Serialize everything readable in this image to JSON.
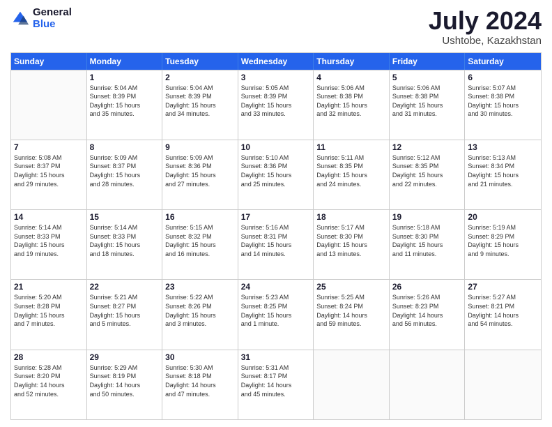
{
  "logo": {
    "general": "General",
    "blue": "Blue"
  },
  "title": "July 2024",
  "location": "Ushtobe, Kazakhstan",
  "header_days": [
    "Sunday",
    "Monday",
    "Tuesday",
    "Wednesday",
    "Thursday",
    "Friday",
    "Saturday"
  ],
  "weeks": [
    [
      {
        "day": "",
        "info": ""
      },
      {
        "day": "1",
        "info": "Sunrise: 5:04 AM\nSunset: 8:39 PM\nDaylight: 15 hours\nand 35 minutes."
      },
      {
        "day": "2",
        "info": "Sunrise: 5:04 AM\nSunset: 8:39 PM\nDaylight: 15 hours\nand 34 minutes."
      },
      {
        "day": "3",
        "info": "Sunrise: 5:05 AM\nSunset: 8:39 PM\nDaylight: 15 hours\nand 33 minutes."
      },
      {
        "day": "4",
        "info": "Sunrise: 5:06 AM\nSunset: 8:38 PM\nDaylight: 15 hours\nand 32 minutes."
      },
      {
        "day": "5",
        "info": "Sunrise: 5:06 AM\nSunset: 8:38 PM\nDaylight: 15 hours\nand 31 minutes."
      },
      {
        "day": "6",
        "info": "Sunrise: 5:07 AM\nSunset: 8:38 PM\nDaylight: 15 hours\nand 30 minutes."
      }
    ],
    [
      {
        "day": "7",
        "info": "Sunrise: 5:08 AM\nSunset: 8:37 PM\nDaylight: 15 hours\nand 29 minutes."
      },
      {
        "day": "8",
        "info": "Sunrise: 5:09 AM\nSunset: 8:37 PM\nDaylight: 15 hours\nand 28 minutes."
      },
      {
        "day": "9",
        "info": "Sunrise: 5:09 AM\nSunset: 8:36 PM\nDaylight: 15 hours\nand 27 minutes."
      },
      {
        "day": "10",
        "info": "Sunrise: 5:10 AM\nSunset: 8:36 PM\nDaylight: 15 hours\nand 25 minutes."
      },
      {
        "day": "11",
        "info": "Sunrise: 5:11 AM\nSunset: 8:35 PM\nDaylight: 15 hours\nand 24 minutes."
      },
      {
        "day": "12",
        "info": "Sunrise: 5:12 AM\nSunset: 8:35 PM\nDaylight: 15 hours\nand 22 minutes."
      },
      {
        "day": "13",
        "info": "Sunrise: 5:13 AM\nSunset: 8:34 PM\nDaylight: 15 hours\nand 21 minutes."
      }
    ],
    [
      {
        "day": "14",
        "info": "Sunrise: 5:14 AM\nSunset: 8:33 PM\nDaylight: 15 hours\nand 19 minutes."
      },
      {
        "day": "15",
        "info": "Sunrise: 5:14 AM\nSunset: 8:33 PM\nDaylight: 15 hours\nand 18 minutes."
      },
      {
        "day": "16",
        "info": "Sunrise: 5:15 AM\nSunset: 8:32 PM\nDaylight: 15 hours\nand 16 minutes."
      },
      {
        "day": "17",
        "info": "Sunrise: 5:16 AM\nSunset: 8:31 PM\nDaylight: 15 hours\nand 14 minutes."
      },
      {
        "day": "18",
        "info": "Sunrise: 5:17 AM\nSunset: 8:30 PM\nDaylight: 15 hours\nand 13 minutes."
      },
      {
        "day": "19",
        "info": "Sunrise: 5:18 AM\nSunset: 8:30 PM\nDaylight: 15 hours\nand 11 minutes."
      },
      {
        "day": "20",
        "info": "Sunrise: 5:19 AM\nSunset: 8:29 PM\nDaylight: 15 hours\nand 9 minutes."
      }
    ],
    [
      {
        "day": "21",
        "info": "Sunrise: 5:20 AM\nSunset: 8:28 PM\nDaylight: 15 hours\nand 7 minutes."
      },
      {
        "day": "22",
        "info": "Sunrise: 5:21 AM\nSunset: 8:27 PM\nDaylight: 15 hours\nand 5 minutes."
      },
      {
        "day": "23",
        "info": "Sunrise: 5:22 AM\nSunset: 8:26 PM\nDaylight: 15 hours\nand 3 minutes."
      },
      {
        "day": "24",
        "info": "Sunrise: 5:23 AM\nSunset: 8:25 PM\nDaylight: 15 hours\nand 1 minute."
      },
      {
        "day": "25",
        "info": "Sunrise: 5:25 AM\nSunset: 8:24 PM\nDaylight: 14 hours\nand 59 minutes."
      },
      {
        "day": "26",
        "info": "Sunrise: 5:26 AM\nSunset: 8:23 PM\nDaylight: 14 hours\nand 56 minutes."
      },
      {
        "day": "27",
        "info": "Sunrise: 5:27 AM\nSunset: 8:21 PM\nDaylight: 14 hours\nand 54 minutes."
      }
    ],
    [
      {
        "day": "28",
        "info": "Sunrise: 5:28 AM\nSunset: 8:20 PM\nDaylight: 14 hours\nand 52 minutes."
      },
      {
        "day": "29",
        "info": "Sunrise: 5:29 AM\nSunset: 8:19 PM\nDaylight: 14 hours\nand 50 minutes."
      },
      {
        "day": "30",
        "info": "Sunrise: 5:30 AM\nSunset: 8:18 PM\nDaylight: 14 hours\nand 47 minutes."
      },
      {
        "day": "31",
        "info": "Sunrise: 5:31 AM\nSunset: 8:17 PM\nDaylight: 14 hours\nand 45 minutes."
      },
      {
        "day": "",
        "info": ""
      },
      {
        "day": "",
        "info": ""
      },
      {
        "day": "",
        "info": ""
      }
    ]
  ]
}
